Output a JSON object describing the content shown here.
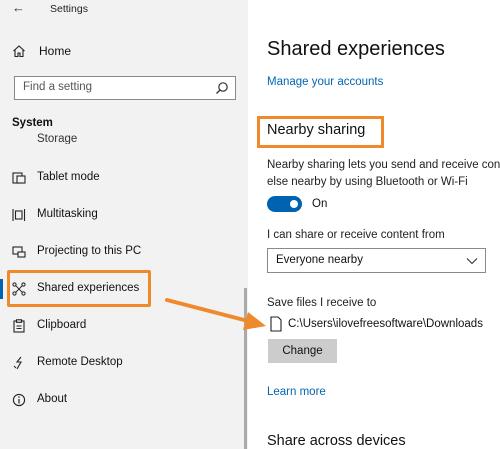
{
  "window": {
    "title": "Settings"
  },
  "sidebar": {
    "home_label": "Home",
    "search_placeholder": "Find a setting",
    "section_title": "System",
    "partial_item": "Storage",
    "items": [
      {
        "label": "Tablet mode",
        "icon": "tablet-mode-icon"
      },
      {
        "label": "Multitasking",
        "icon": "multitasking-icon"
      },
      {
        "label": "Projecting to this PC",
        "icon": "projecting-icon"
      },
      {
        "label": "Shared experiences",
        "icon": "shared-experiences-icon",
        "selected": true
      },
      {
        "label": "Clipboard",
        "icon": "clipboard-icon"
      },
      {
        "label": "Remote Desktop",
        "icon": "remote-desktop-icon"
      },
      {
        "label": "About",
        "icon": "info-icon"
      }
    ]
  },
  "main": {
    "title": "Shared experiences",
    "manage_link": "Manage your accounts",
    "nearby_heading": "Nearby sharing",
    "description_line1": "Nearby sharing lets you send and receive con",
    "description_line2": "else nearby by using Bluetooth or Wi-Fi",
    "toggle_label": "On",
    "share_label": "I can share or receive content from",
    "dropdown_value": "Everyone nearby",
    "save_label": "Save files I receive to",
    "save_path": "C:\\Users\\ilovefreesoftware\\Downloads",
    "change_button": "Change",
    "learn_more": "Learn more",
    "share_across_heading": "Share across devices"
  },
  "colors": {
    "accent": "#0063b1",
    "link": "#0066b4",
    "annotation": "#ef8a2c",
    "sidebar_bg": "#f2f2f2"
  }
}
